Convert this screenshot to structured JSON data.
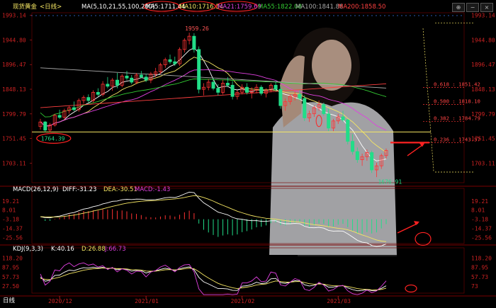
{
  "header": {
    "symbol": "现货黄金",
    "period": "<日线>",
    "ma_params": "MA(5,10,21,55,100,200)",
    "ma_values": [
      {
        "label": "MA5:1711.44",
        "color": "#ffffff"
      },
      {
        "label": "MA10:1716.34",
        "color": "#f5e663"
      },
      {
        "label": "MA21:1759.69",
        "color": "#e040e0"
      },
      {
        "label": "MA55:1822.08",
        "color": "#33cc33"
      },
      {
        "label": "MA100:1841.88",
        "color": "#aaaaaa"
      },
      {
        "label": "MA200:1858.50",
        "color": "#ff4040"
      }
    ]
  },
  "toolbar": {
    "buttons": [
      "⊕",
      "−",
      "×"
    ]
  },
  "price_axis": {
    "labels": [
      "1993.14",
      "1944.80",
      "1896.47",
      "1848.13",
      "1799.79",
      "1751.45",
      "1703.11"
    ],
    "values": [
      1993.14,
      1944.8,
      1896.47,
      1848.13,
      1799.79,
      1751.45,
      1703.11
    ]
  },
  "annotations": {
    "high_label": "1959.26",
    "low_label": "1764.39",
    "recent_low_label": "1676.91",
    "fib_levels": [
      {
        "label": "0.618 : 1851.42",
        "value": 1851.42
      },
      {
        "label": "0.500 : 1818.10",
        "value": 1818.1
      },
      {
        "label": "0.382 : 1784.79",
        "value": 1784.79
      },
      {
        "label": "0.236 : 1743.57",
        "value": 1743.57
      }
    ],
    "support_level": 1764.39,
    "accent_color": "#ff2222"
  },
  "macd": {
    "header_title": "MACD(26,12,9)",
    "diff_label": "DIFF:-31.23",
    "dea_label": "DEA:-30.51",
    "macd_label": "MACD:-1.43",
    "axis_labels": [
      "19.21",
      "8.01",
      "-3.18",
      "-14.37",
      "-25.56"
    ],
    "axis_values": [
      19.21,
      8.01,
      -3.18,
      -14.37,
      -25.56
    ]
  },
  "kdj": {
    "header_title": "KDJ(9,3,3)",
    "k_label": "K:40.16",
    "d_label": "D:26.88",
    "j_label": "J:66.73",
    "axis_labels": [
      "118.20",
      "87.95",
      "57.73",
      "27.50"
    ],
    "axis_values": [
      118.2,
      87.95,
      57.73,
      27.5
    ],
    "axis_labels_right": [
      "118.20",
      "87.95",
      "57.73",
      "73"
    ]
  },
  "footer": {
    "period_tab": "日线",
    "date_labels": [
      "2020/12",
      "2021/01",
      "2021/02",
      "2021/03"
    ]
  },
  "chart_data": {
    "type": "candlestick",
    "title": "现货黄金 <日线>",
    "ylim": [
      1665,
      1998
    ],
    "candles": [
      [
        1775,
        1790,
        1769,
        1784
      ],
      [
        1784,
        1786,
        1764,
        1768
      ],
      [
        1768,
        1782,
        1764,
        1778
      ],
      [
        1778,
        1800,
        1775,
        1797
      ],
      [
        1797,
        1808,
        1790,
        1793
      ],
      [
        1793,
        1810,
        1788,
        1806
      ],
      [
        1806,
        1816,
        1800,
        1812
      ],
      [
        1812,
        1824,
        1805,
        1808
      ],
      [
        1808,
        1830,
        1804,
        1826
      ],
      [
        1826,
        1836,
        1820,
        1832
      ],
      [
        1832,
        1838,
        1822,
        1826
      ],
      [
        1826,
        1846,
        1822,
        1842
      ],
      [
        1842,
        1850,
        1834,
        1838
      ],
      [
        1838,
        1864,
        1834,
        1858
      ],
      [
        1858,
        1872,
        1850,
        1854
      ],
      [
        1854,
        1870,
        1845,
        1866
      ],
      [
        1866,
        1880,
        1850,
        1856
      ],
      [
        1856,
        1878,
        1852,
        1874
      ],
      [
        1874,
        1884,
        1866,
        1870
      ],
      [
        1870,
        1876,
        1858,
        1862
      ],
      [
        1862,
        1880,
        1858,
        1876
      ],
      [
        1876,
        1884,
        1870,
        1872
      ],
      [
        1872,
        1878,
        1862,
        1866
      ],
      [
        1866,
        1882,
        1860,
        1878
      ],
      [
        1878,
        1890,
        1872,
        1882
      ],
      [
        1882,
        1900,
        1878,
        1896
      ],
      [
        1896,
        1910,
        1890,
        1906
      ],
      [
        1906,
        1916,
        1898,
        1902
      ],
      [
        1902,
        1912,
        1894,
        1898
      ],
      [
        1898,
        1930,
        1894,
        1926
      ],
      [
        1926,
        1948,
        1920,
        1944
      ],
      [
        1944,
        1959,
        1936,
        1952
      ],
      [
        1952,
        1958,
        1920,
        1926
      ],
      [
        1926,
        1932,
        1840,
        1848
      ],
      [
        1848,
        1860,
        1836,
        1852
      ],
      [
        1852,
        1868,
        1846,
        1862
      ],
      [
        1862,
        1870,
        1846,
        1850
      ],
      [
        1850,
        1858,
        1836,
        1842
      ],
      [
        1842,
        1866,
        1838,
        1860
      ],
      [
        1860,
        1872,
        1852,
        1856
      ],
      [
        1856,
        1864,
        1828,
        1834
      ],
      [
        1834,
        1846,
        1828,
        1842
      ],
      [
        1842,
        1858,
        1838,
        1852
      ],
      [
        1852,
        1860,
        1838,
        1842
      ],
      [
        1842,
        1852,
        1830,
        1846
      ],
      [
        1846,
        1858,
        1840,
        1852
      ],
      [
        1852,
        1856,
        1836,
        1840
      ],
      [
        1840,
        1850,
        1832,
        1846
      ],
      [
        1846,
        1860,
        1842,
        1856
      ],
      [
        1856,
        1864,
        1844,
        1848
      ],
      [
        1848,
        1854,
        1810,
        1816
      ],
      [
        1816,
        1830,
        1806,
        1824
      ],
      [
        1824,
        1838,
        1818,
        1834
      ],
      [
        1834,
        1844,
        1826,
        1838
      ],
      [
        1838,
        1846,
        1826,
        1830
      ],
      [
        1830,
        1836,
        1786,
        1792
      ],
      [
        1792,
        1806,
        1784,
        1800
      ],
      [
        1800,
        1816,
        1794,
        1812
      ],
      [
        1812,
        1826,
        1806,
        1818
      ],
      [
        1818,
        1822,
        1796,
        1800
      ],
      [
        1800,
        1810,
        1766,
        1772
      ],
      [
        1772,
        1790,
        1766,
        1786
      ],
      [
        1786,
        1800,
        1780,
        1794
      ],
      [
        1794,
        1806,
        1784,
        1788
      ],
      [
        1788,
        1790,
        1740,
        1746
      ],
      [
        1746,
        1760,
        1720,
        1726
      ],
      [
        1726,
        1734,
        1704,
        1710
      ],
      [
        1710,
        1722,
        1698,
        1716
      ],
      [
        1716,
        1730,
        1708,
        1724
      ],
      [
        1724,
        1728,
        1684,
        1690
      ],
      [
        1690,
        1704,
        1676,
        1698
      ],
      [
        1698,
        1722,
        1692,
        1718
      ],
      [
        1718,
        1732,
        1712,
        1728
      ]
    ],
    "x_ticks": [
      {
        "label": "2020/12",
        "index": 4
      },
      {
        "label": "2021/01",
        "index": 22
      },
      {
        "label": "2021/02",
        "index": 42
      },
      {
        "label": "2021/03",
        "index": 62
      }
    ],
    "series": [
      {
        "name": "MA5",
        "color": "#ffffff"
      },
      {
        "name": "MA10",
        "color": "#f5e663"
      },
      {
        "name": "MA21",
        "color": "#e040e0"
      },
      {
        "name": "MA55",
        "color": "#33cc33"
      },
      {
        "name": "MA100",
        "color": "#aaaaaa"
      },
      {
        "name": "MA200",
        "color": "#ff4040"
      }
    ],
    "horizontal_lines": [
      {
        "value": 1764.39,
        "color": "#f5e663"
      }
    ],
    "macd_ylim": [
      -33,
      26
    ],
    "kdj_ylim": [
      5,
      128
    ]
  }
}
